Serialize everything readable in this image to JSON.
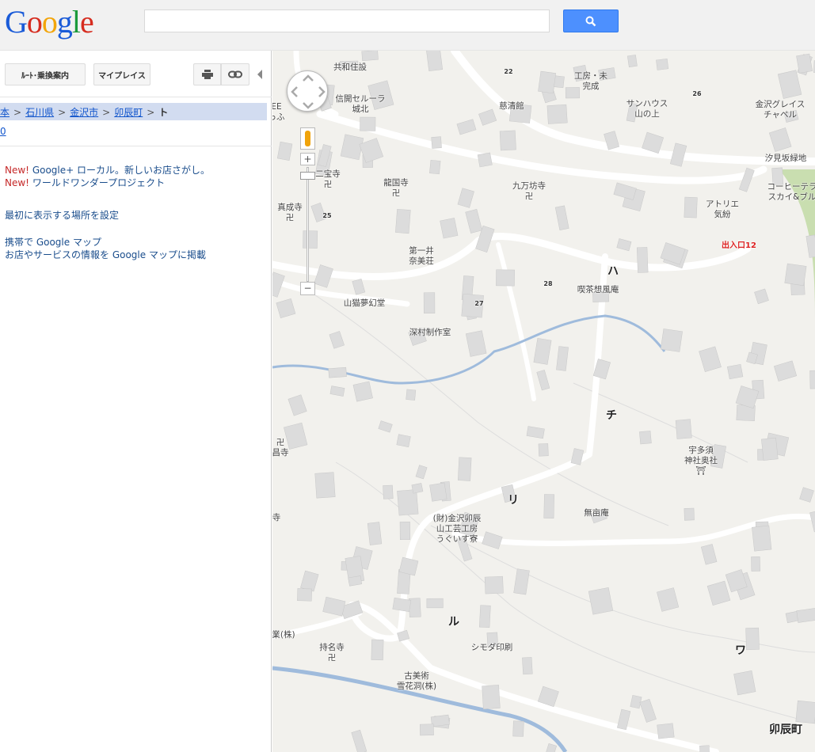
{
  "header": {
    "logo": "Google",
    "search_value": "",
    "search_placeholder": ""
  },
  "panel": {
    "route_button": "ﾙｰﾄ･乗換案内",
    "myplaces_button": "マイプレイス",
    "breadcrumb": [
      "本",
      "石川県",
      "金沢市",
      "卯辰町"
    ],
    "breadcrumb_current": "ト",
    "breadcrumb_sep": ">",
    "sub_link": "0",
    "news": [
      {
        "badge": "New!",
        "text": "Google+ ローカル。新しいお店さがし。"
      },
      {
        "badge": "New!",
        "text": "ワールドワンダープロジェクト"
      }
    ],
    "set_default": "最初に表示する場所を設定",
    "mobile": "携帯で Google マップ",
    "business": "お店やサービスの情報を Google マップに掲載"
  },
  "map": {
    "labels": [
      "共和住設",
      "22",
      "工房・未\n完成",
      "26",
      "サンハウス\n山の上",
      "金沢グレイス\nチャペル",
      "信開セルーラ\n城北",
      "慈清館",
      "汐見坂緑地",
      "二宝寺\n卍",
      "龍国寺\n卍",
      "九万坊寺\n卍",
      "コーヒーテラ\nスカイ&ブル",
      "アトリエ\n気紛",
      "真成寺\n卍",
      "25",
      "出入口12",
      "第一井\n奈美荘",
      "ハ",
      "28",
      "喫茶想風庵",
      "山猫夢幻堂",
      "27",
      "深村制作室",
      "チ",
      "宇多須\n神社奥社\n⛩",
      "卍\n昌寺",
      "リ",
      "無亩庵",
      "(財)金沢卯辰\n山工芸工房\nうぐいす寮",
      "寺",
      "ル",
      "業(株)",
      "持名寺\n卍",
      "シモダ印刷",
      "古美術\n雪花洞(株)",
      "ワ",
      "卯辰町",
      "EE\nっふ"
    ]
  },
  "colors": {
    "accent": "#4d90fe",
    "road": "#ffffff",
    "building": "#dcdcdc",
    "water": "#9fbbdc",
    "park": "#c9deb0"
  }
}
